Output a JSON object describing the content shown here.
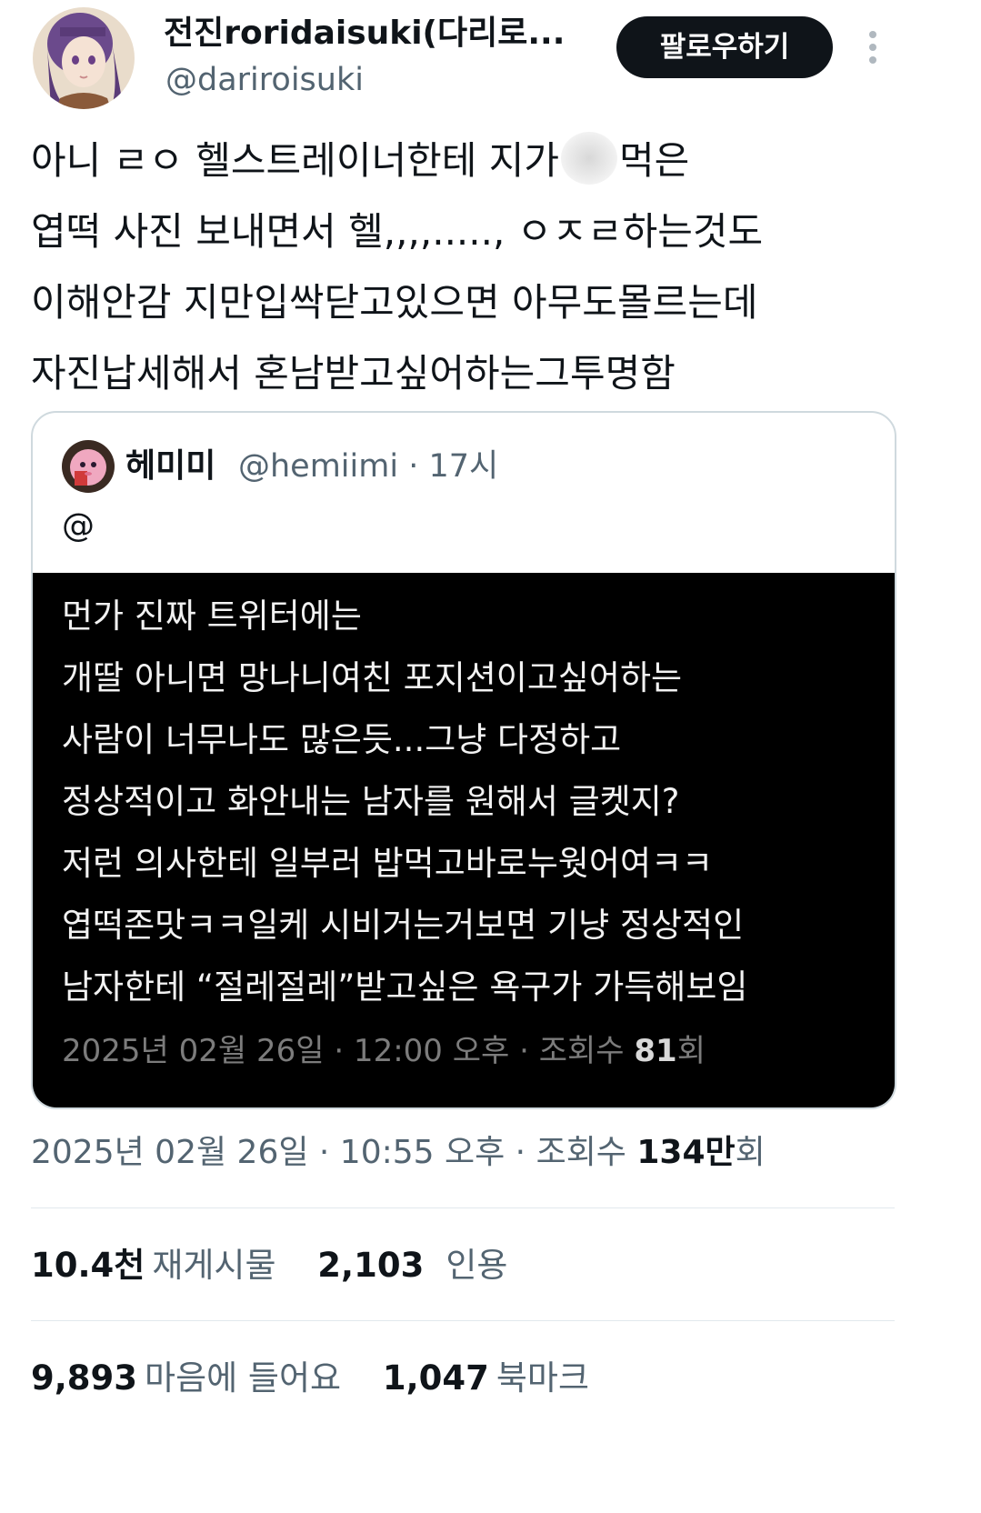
{
  "author": {
    "display_name": "전진roridaisuki(다리로...",
    "handle": "@dariroisuki",
    "follow_label": "팔로우하기"
  },
  "tweet": {
    "lines": [
      {
        "before": "아니 ㄹㅇ 헬스트레이너한테 지가",
        "after": "먹은"
      },
      "엽떡 사진 보내면서 헬,,,,.....,  ㅇㅈㄹ하는것도",
      "이해안감 지만입싹닫고있으면 아무도몰르는데",
      "자진납세해서 혼남받고싶어하는그투명함"
    ]
  },
  "quote": {
    "display_name": "헤미미",
    "handle_time": "@hemiimi · 17시",
    "text": "@",
    "image_lines": [
      "먼가 진짜 트위터에는",
      "개딸 아니면 망나니여친 포지션이고싶어하는",
      "사람이 너무나도 많은듯...그냥 다정하고",
      "정상적이고 화안내는 남자를 원해서 글켓지?",
      "저런 의사한테 일부러 밥먹고바로누웟어여ㅋㅋ",
      "엽떡존맛ㅋㅋ일케 시비거는거보면 기냥 정상적인",
      "남자한테 “절레절레”받고싶은 욕구가 가득해보임"
    ],
    "image_meta_prefix": "2025년 02월 26일 · 12:00 오후 · 조회수 ",
    "image_meta_count": "81",
    "image_meta_suffix": "회"
  },
  "meta": {
    "prefix": "2025년 02월 26일 · 10:55 오후 · 조회수 ",
    "count": "134만",
    "suffix": "회"
  },
  "stats": {
    "retweets": {
      "count": "10.4천",
      "label": "재게시물"
    },
    "quotes": {
      "count": "2,103",
      "label": "인용"
    },
    "likes": {
      "count": "9,893",
      "label": "마음에 들어요"
    },
    "bookmarks": {
      "count": "1,047",
      "label": "북마크"
    }
  }
}
